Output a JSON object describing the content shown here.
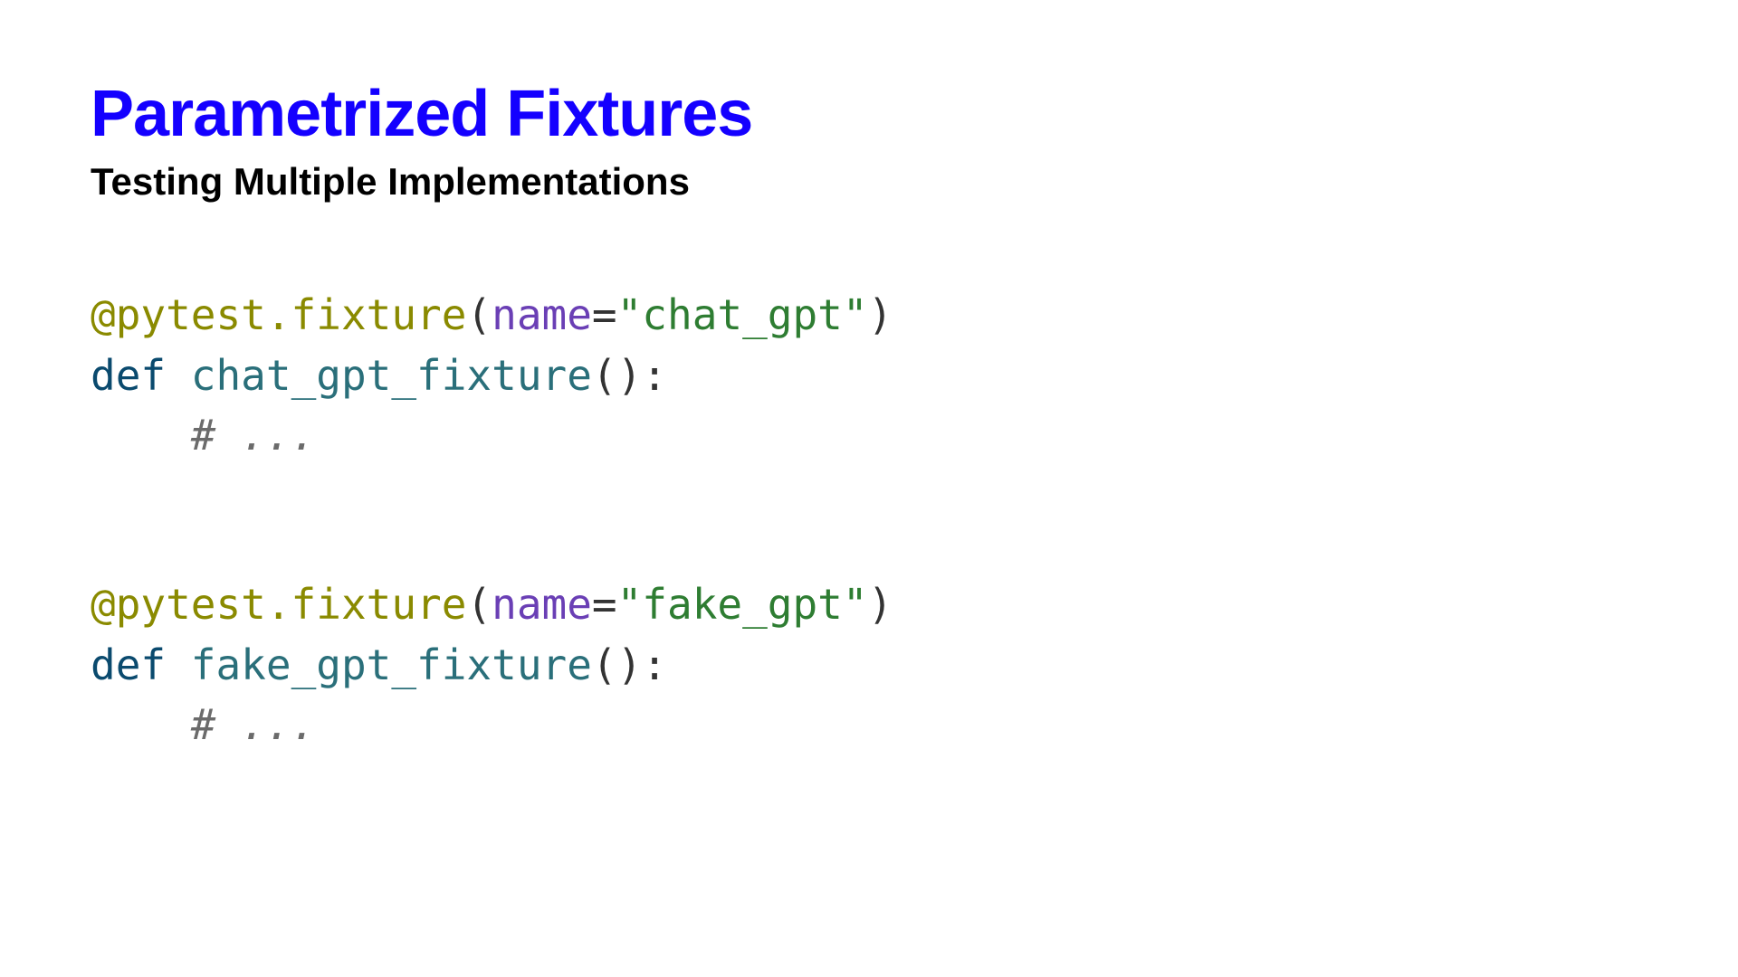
{
  "title": "Parametrized Fixtures",
  "subtitle": "Testing Multiple Implementations",
  "code1": {
    "decorator": "@pytest.fixture",
    "lparen": "(",
    "param": "name",
    "eq": "=",
    "string": "\"chat_gpt\"",
    "rparen": ")",
    "def": "def",
    "space": " ",
    "funcname": "chat_gpt_fixture",
    "sig": "():",
    "indent": "    ",
    "comment": "# ..."
  },
  "code2": {
    "decorator": "@pytest.fixture",
    "lparen": "(",
    "param": "name",
    "eq": "=",
    "string": "\"fake_gpt\"",
    "rparen": ")",
    "def": "def",
    "space": " ",
    "funcname": "fake_gpt_fixture",
    "sig": "():",
    "indent": "    ",
    "comment": "# ..."
  }
}
